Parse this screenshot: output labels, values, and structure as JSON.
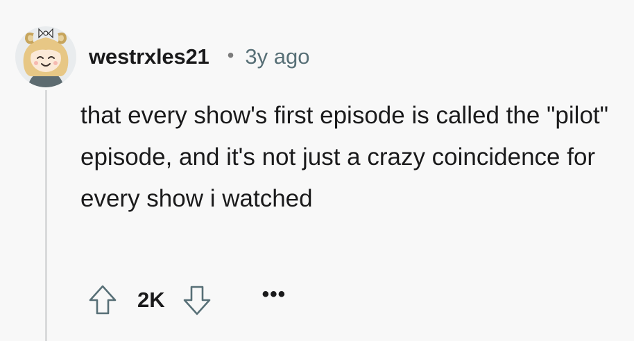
{
  "comment": {
    "username": "westrxles21",
    "separator": "•",
    "timestamp": "3y ago",
    "body": "that every show's first episode is called the \"pilot\" episode, and it's not just a crazy coincidence for every show i watched",
    "score": "2K",
    "more_label": "•••"
  },
  "icons": {
    "avatar": "avatar-icon",
    "upvote": "arrow-up-icon",
    "downvote": "arrow-down-icon",
    "more": "more-options-icon"
  },
  "colors": {
    "background": "#f8f8f8",
    "text": "#1a1a1b",
    "meta": "#576f76",
    "thread_line": "#d9dadb",
    "icon_stroke": "#576f76"
  }
}
